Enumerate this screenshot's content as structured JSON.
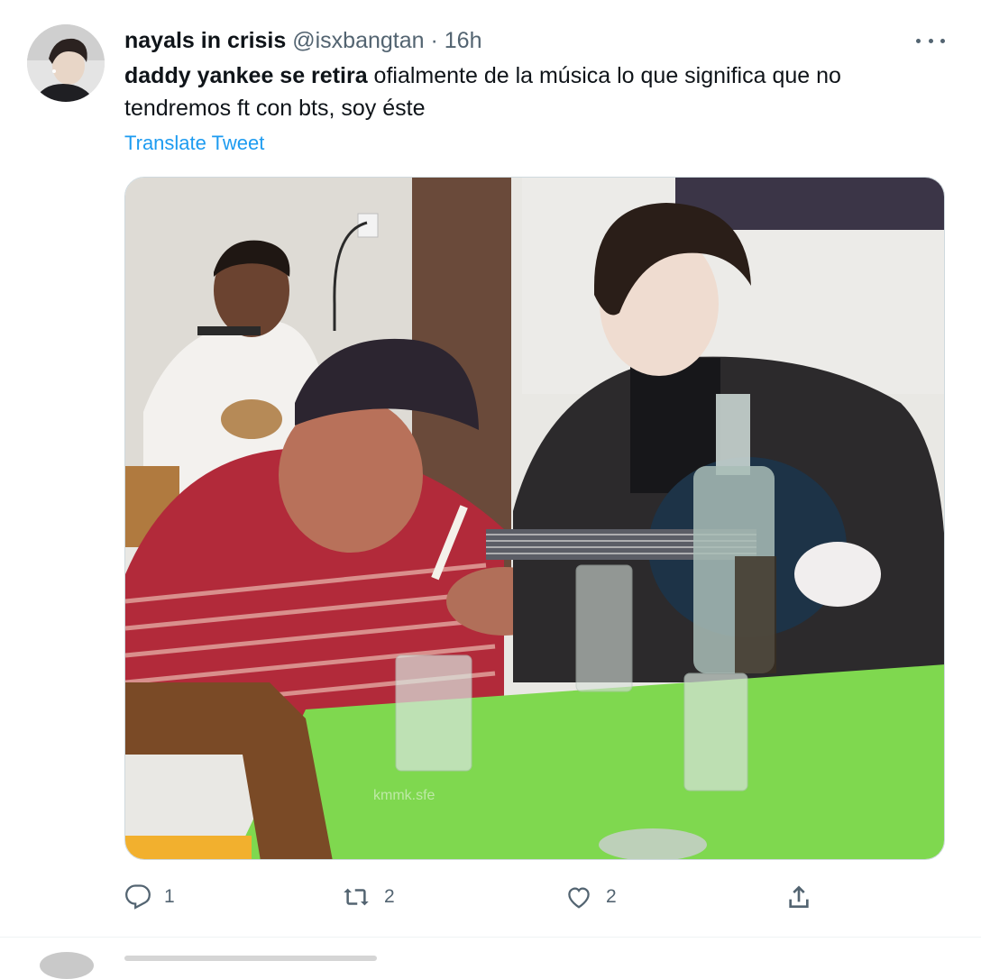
{
  "tweet": {
    "author": {
      "display_name": "nayals in crisis",
      "handle": "@isxbangtan",
      "separator": "·",
      "time": "16h"
    },
    "text": {
      "bold_part": "daddy yankee se retira",
      "rest_line1": " ofialmente de la música lo que significa que no",
      "rest_line2": "tendremos ft con bts, soy éste"
    },
    "translate_label": "Translate Tweet",
    "media": {
      "watermark": "kmmk.sfe"
    },
    "actions": {
      "reply": {
        "icon": "reply-icon",
        "count": "1"
      },
      "retweet": {
        "icon": "retweet-icon",
        "count": "2"
      },
      "like": {
        "icon": "heart-icon",
        "count": "2"
      },
      "share": {
        "icon": "share-icon"
      }
    },
    "more_icon": "more-horizontal-icon"
  },
  "colors": {
    "text": "#0f1419",
    "secondary": "#536471",
    "link": "#1d9bf0",
    "border": "#cfd9de"
  }
}
